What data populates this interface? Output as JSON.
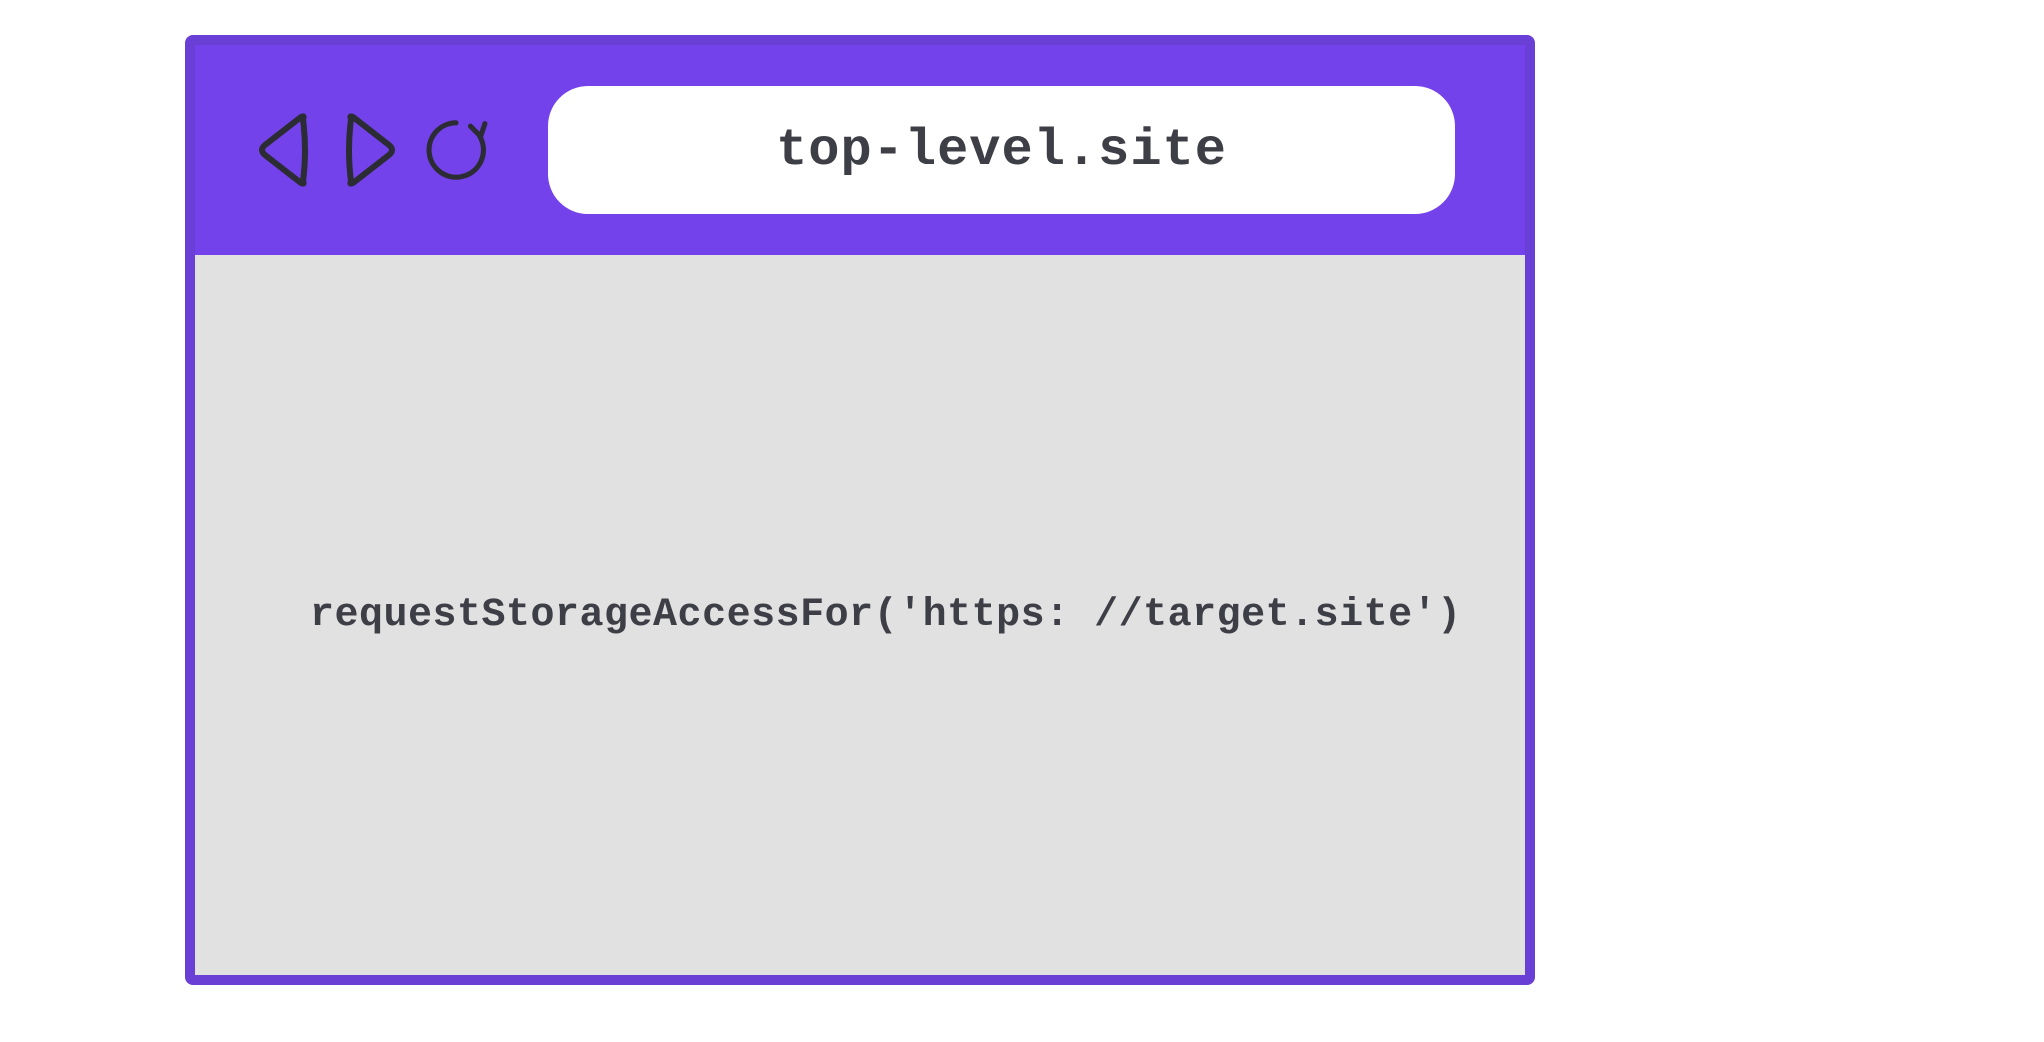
{
  "browser": {
    "toolbar": {
      "back_icon": "back-triangle-icon",
      "forward_icon": "forward-triangle-icon",
      "reload_icon": "reload-icon"
    },
    "address_bar": {
      "url": "top-level.site"
    },
    "content": {
      "code": "requestStorageAccessFor('https: //target.site')"
    }
  },
  "colors": {
    "border": "#6a3fd6",
    "toolbar_bg": "#7342eb",
    "content_bg": "#e1e1e1",
    "text": "#3e3e47",
    "icon_stroke": "#2c2c34"
  }
}
